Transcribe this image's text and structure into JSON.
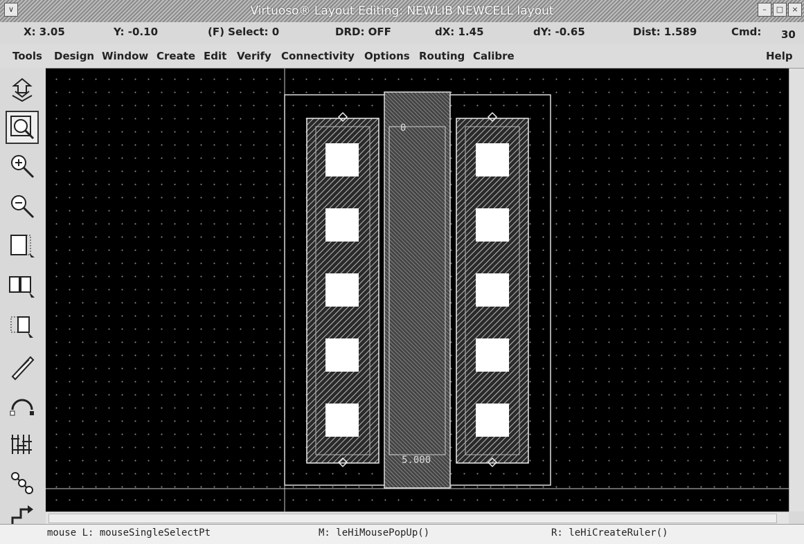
{
  "window": {
    "title": "Virtuoso® Layout Editing: NEWLIB NEWCELL layout"
  },
  "status": {
    "x": "X: 3.05",
    "y": "Y: -0.10",
    "select": "(F) Select: 0",
    "drd": "DRD: OFF",
    "dx": "dX: 1.45",
    "dy": "dY: -0.65",
    "dist": "Dist: 1.589",
    "cmd_label": "Cmd:",
    "cmd_count": "30"
  },
  "menu": [
    "Tools",
    "Design",
    "Window",
    "Create",
    "Edit",
    "Verify",
    "Connectivity",
    "Options",
    "Routing",
    "Calibre",
    "Help"
  ],
  "toolbar": [
    "save-icon",
    "zoom-fit-icon",
    "zoom-in-icon",
    "zoom-out-icon",
    "stretch-icon",
    "copy-icon",
    "move-icon",
    "path-icon",
    "undo-icon",
    "property-icon",
    "hierarchy-icon",
    "step-icon"
  ],
  "ruler": {
    "start_label": "0",
    "end_label": "5.000"
  },
  "mouse": {
    "left": "mouse L: mouseSingleSelectPt",
    "middle": "M: leHiMousePopUp()",
    "right": "R: leHiCreateRuler()"
  }
}
